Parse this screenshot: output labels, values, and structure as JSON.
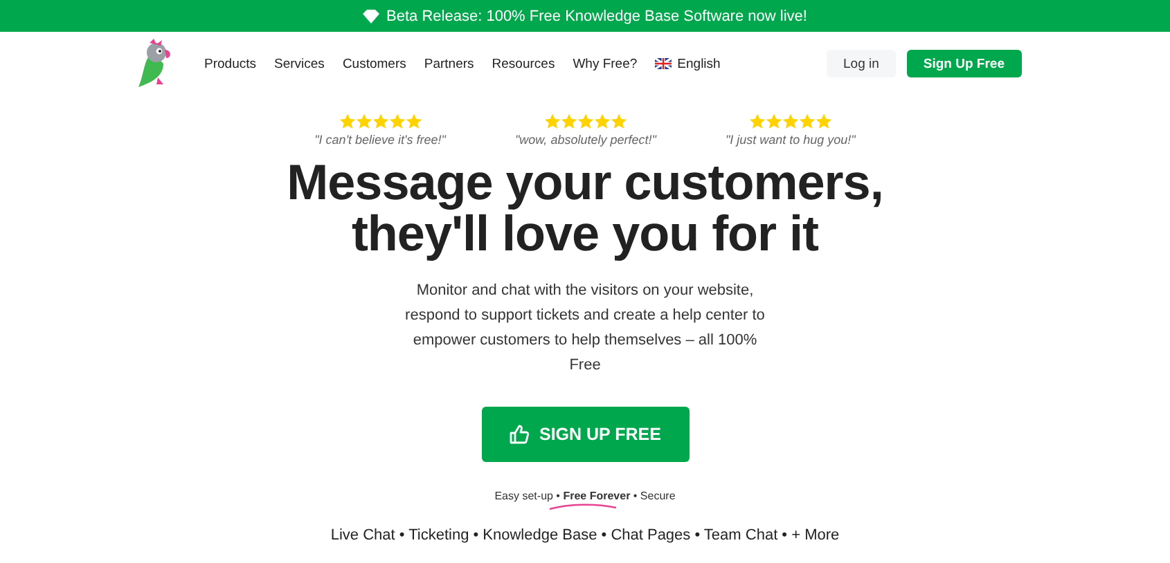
{
  "banner": {
    "text": "Beta Release: 100% Free Knowledge Base Software now live!"
  },
  "nav": {
    "items": [
      "Products",
      "Services",
      "Customers",
      "Partners",
      "Resources",
      "Why Free?"
    ],
    "language": "English",
    "login": "Log in",
    "signup": "Sign Up Free"
  },
  "testimonials": [
    {
      "stars": 5,
      "quote": "\"I can't believe it's free!\""
    },
    {
      "stars": 5,
      "quote": "\"wow, absolutely perfect!\""
    },
    {
      "stars": 5,
      "quote": "\"I just want to hug you!\""
    }
  ],
  "headline": [
    "Message your customers,",
    "they'll love you for it"
  ],
  "description": "Monitor and chat with the visitors on your website, respond to support tickets and create a help center to empower customers to help themselves – all 100% Free",
  "cta": "SIGN UP FREE",
  "tagline": "Easy set-up • **Free Forever** • Secure",
  "features": "Live Chat • Ticketing • Knowledge Base • Chat Pages • Team Chat • + More"
}
